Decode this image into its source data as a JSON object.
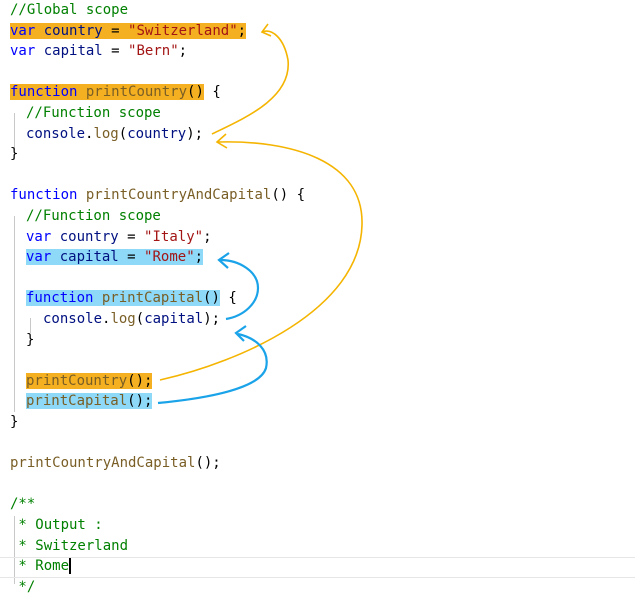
{
  "colors": {
    "comment": "#008000",
    "keyword": "#0000ff",
    "string": "#a31515",
    "identifier": "#001080",
    "function": "#795e26",
    "highlight_orange": "#f5b021",
    "highlight_blue": "#8ed9f8",
    "arrow_orange": "#f4b400",
    "arrow_blue": "#1aa3e8"
  },
  "code": {
    "l1": {
      "comment": "//Global scope"
    },
    "l2": {
      "kw": "var",
      "name": "country",
      "eq": " = ",
      "str": "\"Switzerland\"",
      "semi": ";"
    },
    "l3": {
      "kw": "var",
      "name": "capital",
      "eq": " = ",
      "str": "\"Bern\"",
      "semi": ";"
    },
    "l5": {
      "kw": "function",
      "name": "printCountry",
      "parens": "()",
      "brace": " {"
    },
    "l6": {
      "comment": "//Function scope"
    },
    "l7": {
      "obj": "console",
      "dot": ".",
      "method": "log",
      "open": "(",
      "arg": "country",
      "close": ");"
    },
    "l8": {
      "brace": "}"
    },
    "l10": {
      "kw": "function",
      "name": "printCountryAndCapital",
      "rest": "() {"
    },
    "l11": {
      "comment": "//Function scope"
    },
    "l12": {
      "kw": "var",
      "name": "country",
      "eq": " = ",
      "str": "\"Italy\"",
      "semi": ";"
    },
    "l13": {
      "kw": "var",
      "name": "capital",
      "eq": " = ",
      "str": "\"Rome\"",
      "semi": ";"
    },
    "l15": {
      "kw": "function",
      "name": "printCapital",
      "parens": "()",
      "brace": " {"
    },
    "l16": {
      "obj": "console",
      "dot": ".",
      "method": "log",
      "open": "(",
      "arg": "capital",
      "close": ");"
    },
    "l17": {
      "brace": "}"
    },
    "l19": {
      "call": "printCountry",
      "rest": "();"
    },
    "l20": {
      "call": "printCapital",
      "rest": "();"
    },
    "l21": {
      "brace": "}"
    },
    "l23": {
      "call": "printCountryAndCapital",
      "rest": "();"
    },
    "l25": {
      "comment": "/**"
    },
    "l26": {
      "comment": " * Output :"
    },
    "l27": {
      "comment": " * Switzerland"
    },
    "l28": {
      "comment": " * Rome"
    },
    "l29": {
      "comment": " */"
    }
  },
  "arrows": [
    {
      "name": "arrow-log-country-to-global-country",
      "color": "orange"
    },
    {
      "name": "arrow-printcountry-call-to-definition",
      "color": "orange"
    },
    {
      "name": "arrow-log-capital-to-local-capital",
      "color": "blue"
    },
    {
      "name": "arrow-printcapital-call-to-definition",
      "color": "blue"
    }
  ]
}
